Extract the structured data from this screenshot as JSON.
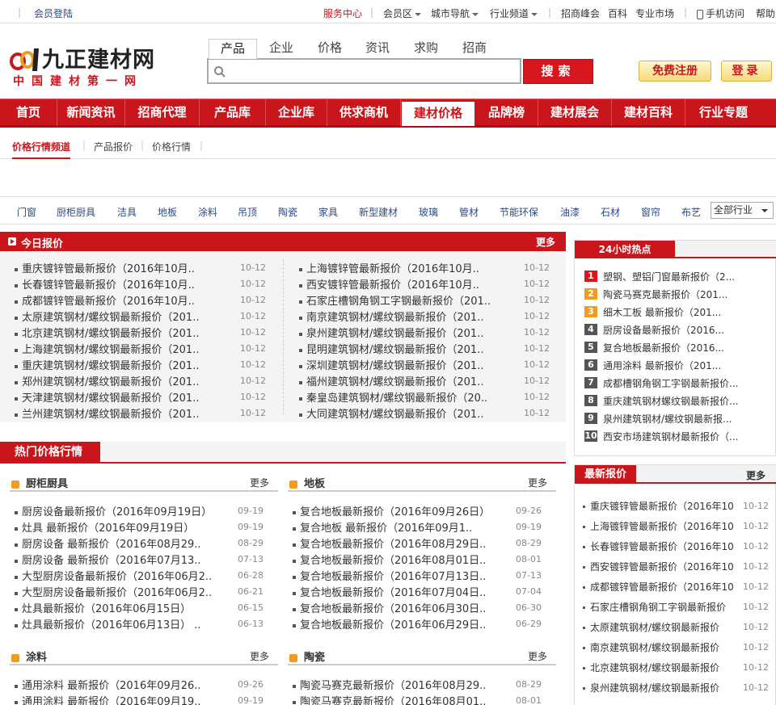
{
  "topbar": {
    "login": "会员登陆",
    "service": "服务中心",
    "member": "会员区",
    "city": "城市导航",
    "industry": "行业频道",
    "summit": "招商峰会",
    "wiki": "百科",
    "market": "专业市场",
    "mobile": "手机访问",
    "help": "帮助"
  },
  "logo": {
    "main": "九正建材网",
    "sub": "中国建材第一网"
  },
  "search": {
    "tabs": [
      "产品",
      "企业",
      "价格",
      "资讯",
      "求购",
      "招商"
    ],
    "placeholder": "",
    "button": "搜索"
  },
  "auth": {
    "register": "免费注册",
    "login": "登录"
  },
  "mainnav": [
    "首页",
    "新闻资讯",
    "招商代理",
    "产品库",
    "企业库",
    "供求商机",
    "建材价格",
    "品牌榜",
    "建材展会",
    "建材百科",
    "行业专题"
  ],
  "subnav": [
    "价格行情频道",
    "产品报价",
    "价格行情"
  ],
  "categories": [
    "门窗",
    "厨柜厨具",
    "洁具",
    "地板",
    "涂料",
    "吊顶",
    "陶瓷",
    "家具",
    "新型建材",
    "玻璃",
    "管材",
    "节能环保",
    "油漆",
    "石材",
    "窗帘",
    "布艺"
  ],
  "category_select": "全部行业",
  "today": {
    "title": "今日报价",
    "more": "更多",
    "left": [
      {
        "t": "重庆镀锌管最新报价（2016年10月..",
        "d": "10-12"
      },
      {
        "t": "长春镀锌管最新报价（2016年10月..",
        "d": "10-12"
      },
      {
        "t": "成都镀锌管最新报价（2016年10月..",
        "d": "10-12"
      },
      {
        "t": "太原建筑钢材/螺纹钢最新报价（201..",
        "d": "10-12"
      },
      {
        "t": "北京建筑钢材/螺纹钢最新报价（201..",
        "d": "10-12"
      },
      {
        "t": "上海建筑钢材/螺纹钢最新报价（201..",
        "d": "10-12"
      },
      {
        "t": "重庆建筑钢材/螺纹钢最新报价（201..",
        "d": "10-12"
      },
      {
        "t": "郑州建筑钢材/螺纹钢最新报价（201..",
        "d": "10-12"
      },
      {
        "t": "天津建筑钢材/螺纹钢最新报价（201..",
        "d": "10-12"
      },
      {
        "t": "兰州建筑钢材/螺纹钢最新报价（201..",
        "d": "10-12"
      }
    ],
    "right": [
      {
        "t": "上海镀锌管最新报价（2016年10月..",
        "d": "10-12"
      },
      {
        "t": "西安镀锌管最新报价（2016年10月..",
        "d": "10-12"
      },
      {
        "t": "石家庄槽钢角钢工字钢最新报价（201..",
        "d": "10-12"
      },
      {
        "t": "南京建筑钢材/螺纹钢最新报价（201..",
        "d": "10-12"
      },
      {
        "t": "泉州建筑钢材/螺纹钢最新报价（201..",
        "d": "10-12"
      },
      {
        "t": "昆明建筑钢材/螺纹钢最新报价（201..",
        "d": "10-12"
      },
      {
        "t": "深圳建筑钢材/螺纹钢最新报价（201..",
        "d": "10-12"
      },
      {
        "t": "福州建筑钢材/螺纹钢最新报价（201..",
        "d": "10-12"
      },
      {
        "t": "秦皇岛建筑钢材/螺纹钢最新报价（20..",
        "d": "10-12"
      },
      {
        "t": "大同建筑钢材/螺纹钢最新报价（201..",
        "d": "10-12"
      }
    ]
  },
  "hot": {
    "title": "热门价格行情",
    "sections": [
      {
        "title": "厨柜厨具",
        "more": "更多",
        "items": [
          {
            "t": "厨房设备最新报价（2016年09月19日）",
            "d": "09-19"
          },
          {
            "t": "灶具 最新报价（2016年09月19日）",
            "d": "09-19"
          },
          {
            "t": "厨房设备 最新报价（2016年08月29..",
            "d": "08-29"
          },
          {
            "t": "厨房设备 最新报价（2016年07月13..",
            "d": "07-13"
          },
          {
            "t": "大型厨房设备最新报价（2016年06月2..",
            "d": "06-28"
          },
          {
            "t": "大型厨房设备最新报价（2016年06月2..",
            "d": "06-21"
          },
          {
            "t": "灶具最新报价（2016年06月15日）",
            "d": "06-15"
          },
          {
            "t": "灶具最新报价（2016年06月13日） ..",
            "d": "06-13"
          }
        ]
      },
      {
        "title": "地板",
        "more": "更多",
        "items": [
          {
            "t": "复合地板最新报价（2016年09月26日）",
            "d": "09-26"
          },
          {
            "t": "复合地板 最新报价（2016年09月1..",
            "d": "09-19"
          },
          {
            "t": "复合地板最新报价（2016年08月29日..",
            "d": "08-29"
          },
          {
            "t": "复合地板最新报价（2016年08月01日..",
            "d": "08-01"
          },
          {
            "t": "复合地板最新报价（2016年07月13日..",
            "d": "07-13"
          },
          {
            "t": "复合地板最新报价（2016年07月04日..",
            "d": "07-04"
          },
          {
            "t": "复合地板最新报价（2016年06月30日..",
            "d": "06-30"
          },
          {
            "t": "复合地板最新报价（2016年06月29日..",
            "d": "06-29"
          }
        ]
      },
      {
        "title": "涂料",
        "more": "更多",
        "items": [
          {
            "t": "通用涂料 最新报价（2016年09月26..",
            "d": "09-26"
          },
          {
            "t": "通用涂料 最新报价（2016年09月19..",
            "d": "09-19"
          }
        ]
      },
      {
        "title": "陶瓷",
        "more": "更多",
        "items": [
          {
            "t": "陶瓷马赛克最新报价（2016年08月29..",
            "d": "08-29"
          },
          {
            "t": "陶瓷马赛克最新报价（2016年08月01..",
            "d": "08-01"
          }
        ]
      }
    ]
  },
  "hot24": {
    "title": "24小时热点",
    "items": [
      "塑钢、塑铝门窗最新报价（2...",
      "陶瓷马赛克最新报价（201...",
      "细木工板 最新报价（201...",
      "厨房设备最新报价（2016...",
      "复合地板最新报价（2016...",
      "通用涂料 最新报价（201...",
      "成都槽钢角钢工字钢最新报价...",
      "重庆建筑钢材螺纹钢最新报价...",
      "泉州建筑钢材/螺纹钢最新报...",
      "西安市场建筑钢材最新报价（..."
    ],
    "ranks": [
      "1",
      "2",
      "3",
      "4",
      "5",
      "6",
      "7",
      "8",
      "9",
      "10"
    ]
  },
  "latest": {
    "title": "最新报价",
    "more": "更多",
    "items": [
      {
        "t": "重庆镀锌管最新报价（2016年10",
        "d": "10-12"
      },
      {
        "t": "上海镀锌管最新报价（2016年10",
        "d": "10-12"
      },
      {
        "t": "长春镀锌管最新报价（2016年10",
        "d": "10-12"
      },
      {
        "t": "西安镀锌管最新报价（2016年10",
        "d": "10-12"
      },
      {
        "t": "成都镀锌管最新报价（2016年10",
        "d": "10-12"
      },
      {
        "t": "石家庄槽钢角钢工字钢最新报价",
        "d": "10-12"
      },
      {
        "t": "太原建筑钢材/螺纹钢最新报价",
        "d": "10-12"
      },
      {
        "t": "南京建筑钢材/螺纹钢最新报价",
        "d": "10-12"
      },
      {
        "t": "北京建筑钢材/螺纹钢最新报价",
        "d": "10-12"
      },
      {
        "t": "泉州建筑钢材/螺纹钢最新报价",
        "d": "10-12"
      }
    ]
  },
  "colors": {
    "brand_red": "#c9161c",
    "rank_red": "#d7161d",
    "rank_orange": "#f29c1f",
    "rank_gray": "#555555"
  }
}
